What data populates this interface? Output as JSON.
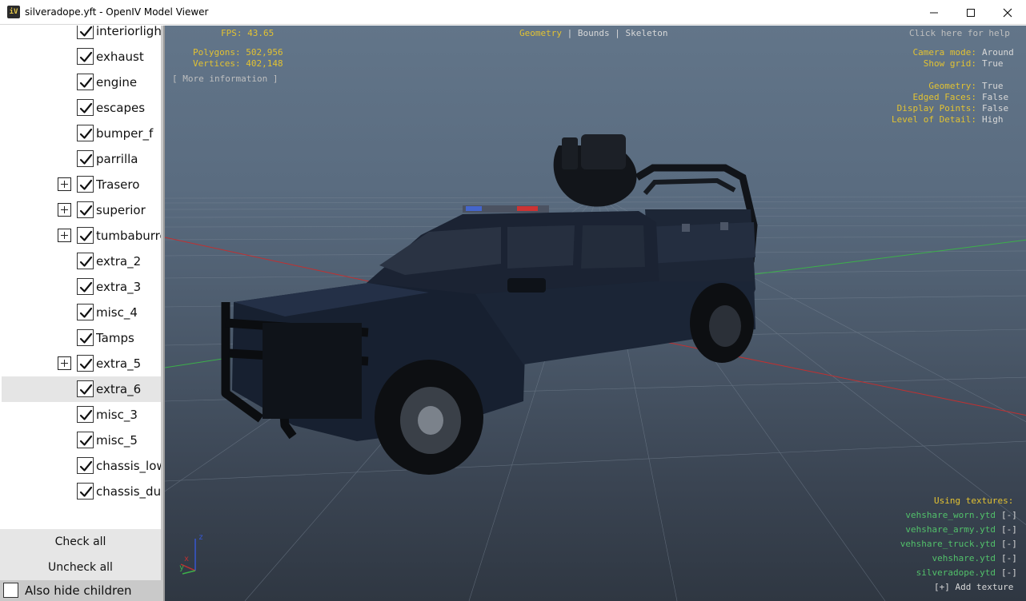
{
  "window": {
    "title": "silveradope.yft - OpenIV Model Viewer",
    "icon_text": "iV",
    "controls": [
      "minimize-icon",
      "maximize-icon",
      "close-icon"
    ]
  },
  "tree": {
    "items": [
      {
        "label": "interiorlight",
        "checked": true,
        "expandable": false
      },
      {
        "label": "exhaust",
        "checked": true,
        "expandable": false
      },
      {
        "label": "engine",
        "checked": true,
        "expandable": false
      },
      {
        "label": "escapes",
        "checked": true,
        "expandable": false
      },
      {
        "label": "bumper_f",
        "checked": true,
        "expandable": false
      },
      {
        "label": "parrilla",
        "checked": true,
        "expandable": false
      },
      {
        "label": "Trasero",
        "checked": true,
        "expandable": true
      },
      {
        "label": "superior",
        "checked": true,
        "expandable": true
      },
      {
        "label": "tumbaburros",
        "checked": true,
        "expandable": true
      },
      {
        "label": "extra_2",
        "checked": true,
        "expandable": false
      },
      {
        "label": "extra_3",
        "checked": true,
        "expandable": false
      },
      {
        "label": "misc_4",
        "checked": true,
        "expandable": false
      },
      {
        "label": "Tamps",
        "checked": true,
        "expandable": false
      },
      {
        "label": "extra_5",
        "checked": true,
        "expandable": true
      },
      {
        "label": "extra_6",
        "checked": true,
        "expandable": false,
        "selected": true
      },
      {
        "label": "misc_3",
        "checked": true,
        "expandable": false
      },
      {
        "label": "misc_5",
        "checked": true,
        "expandable": false
      },
      {
        "label": "chassis_lowlod",
        "checked": true,
        "expandable": false
      },
      {
        "label": "chassis_dummy",
        "checked": true,
        "expandable": false
      }
    ],
    "check_all": "Check all",
    "uncheck_all": "Uncheck all",
    "also_hide_children": "Also hide children"
  },
  "viewport": {
    "fps": "FPS: 43.65",
    "polygons": "Polygons: 502,956",
    "vertices": "Vertices: 402,148",
    "more_info": "[ More information ]",
    "modes": {
      "geometry": "Geometry",
      "sep": "|",
      "bounds": "Bounds",
      "skeleton": "Skeleton"
    },
    "help": "Click here for help",
    "settings": [
      {
        "key": "Camera mode:",
        "value": "Around"
      },
      {
        "key": "Show grid:",
        "value": "True"
      },
      {
        "key": "Geometry:",
        "value": "True"
      },
      {
        "key": "Edged Faces:",
        "value": "False"
      },
      {
        "key": "Display Points:",
        "value": "False"
      },
      {
        "key": "Level of Detail:",
        "value": "High"
      }
    ],
    "textures_title": "Using textures:",
    "textures": [
      {
        "name": "vehshare_worn.ytd",
        "remove": "[-]"
      },
      {
        "name": "vehshare_army.ytd",
        "remove": "[-]"
      },
      {
        "name": "vehshare_truck.ytd",
        "remove": "[-]"
      },
      {
        "name": "vehshare.ytd",
        "remove": "[-]"
      },
      {
        "name": "silveradope.ytd",
        "remove": "[-]"
      }
    ],
    "add_texture": "[+] Add texture",
    "axis": {
      "z": "z",
      "x": "x",
      "y": "y"
    }
  },
  "colors": {
    "hud_yellow": "#e2c232",
    "hud_green": "#52c06a",
    "viewport_top": "#627589",
    "viewport_bottom": "#2f3742",
    "truck_body": "#1b2333"
  }
}
